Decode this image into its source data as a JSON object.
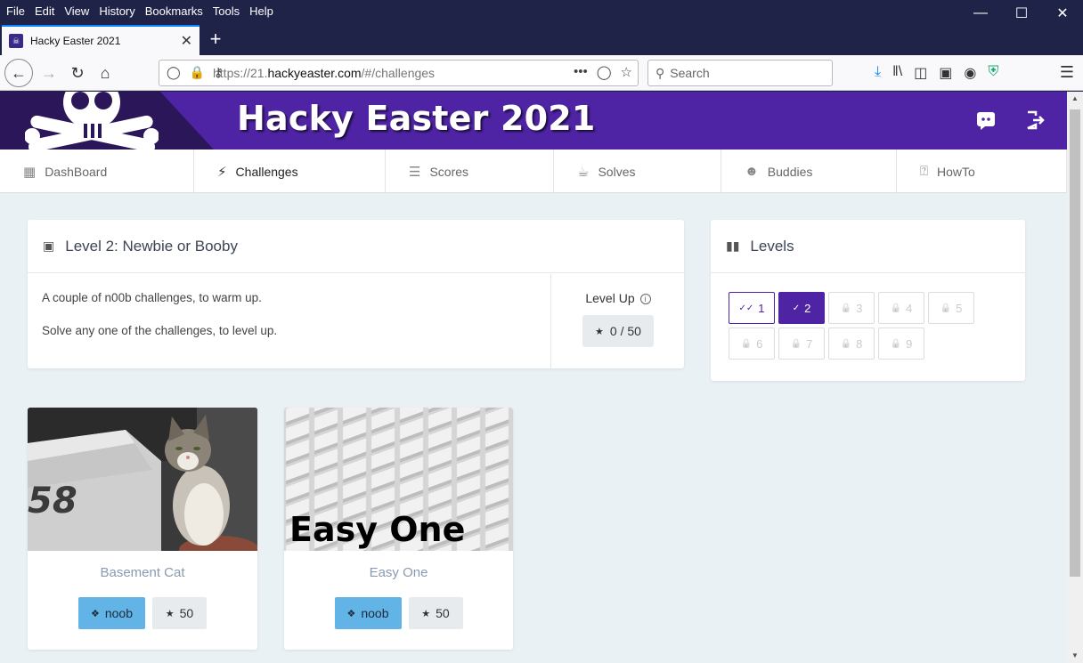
{
  "browser": {
    "menu": [
      "File",
      "Edit",
      "View",
      "History",
      "Bookmarks",
      "Tools",
      "Help"
    ],
    "tab_title": "Hacky Easter 2021",
    "url_prefix": "https://21.",
    "url_host": "hackyeaster.com",
    "url_path": "/#/challenges",
    "search_placeholder": "Search"
  },
  "banner": {
    "title": "Hacky Easter 2021"
  },
  "nav": [
    {
      "label": "DashBoard",
      "icon": "dashboard-icon",
      "active": false
    },
    {
      "label": "Challenges",
      "icon": "lightning-icon",
      "active": true
    },
    {
      "label": "Scores",
      "icon": "list-icon",
      "active": false
    },
    {
      "label": "Solves",
      "icon": "trophy-icon",
      "active": false
    },
    {
      "label": "Buddies",
      "icon": "people-icon",
      "active": false
    },
    {
      "label": "HowTo",
      "icon": "help-icon",
      "active": false
    }
  ],
  "level_card": {
    "title": "Level 2: Newbie or Booby",
    "line1": "A couple of n00b challenges, to warm up.",
    "line2": "Solve any one of the challenges, to level up.",
    "levelup_label": "Level Up",
    "levelup_points": "0 / 50"
  },
  "levels_card": {
    "title": "Levels",
    "levels": [
      {
        "num": "1",
        "state": "done"
      },
      {
        "num": "2",
        "state": "current"
      },
      {
        "num": "3",
        "state": "locked"
      },
      {
        "num": "4",
        "state": "locked"
      },
      {
        "num": "5",
        "state": "locked"
      },
      {
        "num": "6",
        "state": "locked"
      },
      {
        "num": "7",
        "state": "locked"
      },
      {
        "num": "8",
        "state": "locked"
      },
      {
        "num": "9",
        "state": "locked"
      }
    ]
  },
  "challenges": [
    {
      "name": "Basement Cat",
      "category": "noob",
      "points": "50",
      "image": "cat-photo",
      "image_text": "58"
    },
    {
      "name": "Easy One",
      "category": "noob",
      "points": "50",
      "image": "cubes-image",
      "image_text": "Easy One"
    }
  ],
  "colors": {
    "brand": "#4f24a4",
    "noob": "#62b4e6",
    "page_bg": "#eaf1f4"
  }
}
